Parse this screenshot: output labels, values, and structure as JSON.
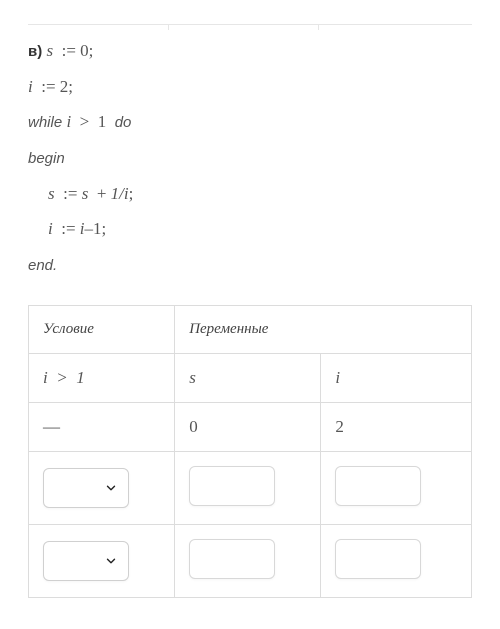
{
  "problem_label": "в)",
  "code": {
    "line1_lhs": "s",
    "line1_rhs": "0",
    "line2_lhs": "i",
    "line2_rhs": "2",
    "while_kw": "while",
    "while_cond_lhs": "i",
    "while_cond_op": ">",
    "while_cond_rhs": "1",
    "do_kw": "do",
    "begin_kw": "begin",
    "body1": "s := s + 1/i;",
    "body1_lhs": "s",
    "body1_rhs_a": "s",
    "body1_rhs_b": "1/i",
    "body2_lhs": "i",
    "body2_rhs_a": "i",
    "body2_rhs_b": "1",
    "end_kw": "end."
  },
  "table": {
    "headers": {
      "condition": "Условие",
      "variables": "Переменные"
    },
    "subheaders": {
      "cond_expr_lhs": "i",
      "cond_expr_op": ">",
      "cond_expr_rhs": "1",
      "s": "s",
      "i": "i"
    },
    "row_initial": {
      "cond": "—",
      "s": "0",
      "i": "2"
    }
  }
}
